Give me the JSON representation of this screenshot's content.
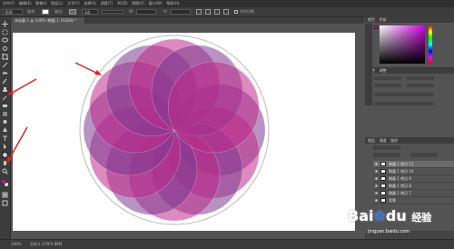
{
  "app": {
    "menus": [
      "文件(F)",
      "编辑(E)",
      "图像(I)",
      "图层(L)",
      "文字(Y)",
      "选择(S)",
      "滤镜(T)",
      "3D(D)",
      "视图(V)",
      "窗口(W)",
      "帮助(H)"
    ]
  },
  "options_bar": {
    "shape_mode": "形状",
    "fill_label": "填充:",
    "stroke_label": "描边:",
    "stroke_width": "3点",
    "w_label": "W:",
    "h_label": "H:",
    "align_edges_label": "对齐边缘"
  },
  "document": {
    "tab_title": "未标题-1 @ 100% (椭圆 1, RGB/8) *"
  },
  "status": {
    "zoom": "100%",
    "doc_info": "文档:1.37M/5.88M"
  },
  "panels": {
    "color_tabs": [
      "颜色",
      "色板"
    ],
    "properties_tabs": [
      "属性",
      "调整"
    ],
    "layers_tabs": [
      "图层",
      "通道",
      "路径"
    ],
    "layers": [
      {
        "name": "椭圆 1 拷贝 11",
        "selected": true
      },
      {
        "name": "椭圆 1 拷贝 10",
        "selected": false
      },
      {
        "name": "椭圆 1 拷贝 9",
        "selected": false
      },
      {
        "name": "椭圆 1 拷贝 8",
        "selected": false
      },
      {
        "name": "椭圆 1 拷贝 7",
        "selected": false
      },
      {
        "name": "背景",
        "selected": false
      }
    ]
  },
  "watermark": {
    "brand": "Bai",
    "brand2": "du",
    "sub": "经验",
    "url": "jingyan.baidu.com"
  },
  "colors": {
    "foreground": "#e0208f",
    "background": "#ffffff",
    "petal": "#c02a8a",
    "petal_dark": "#7a3b8f",
    "arrow": "#e02020"
  }
}
